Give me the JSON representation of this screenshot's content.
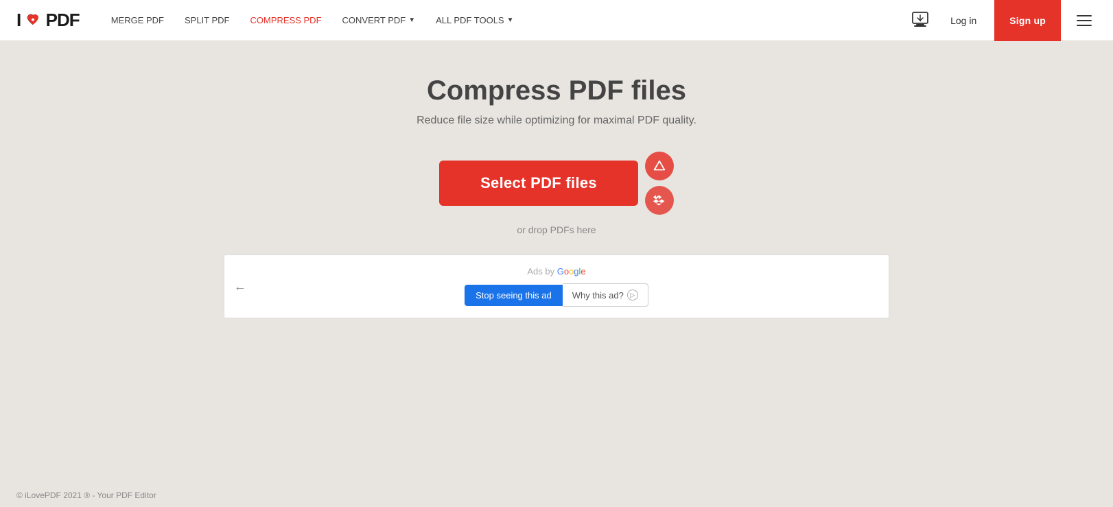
{
  "site": {
    "logo_i": "I",
    "logo_pdf": "PDF"
  },
  "nav": {
    "merge_label": "MERGE PDF",
    "split_label": "SPLIT PDF",
    "compress_label": "COMPRESS PDF",
    "convert_label": "CONVERT PDF",
    "all_tools_label": "ALL PDF TOOLS"
  },
  "header": {
    "login_label": "Log in",
    "signup_label": "Sign up"
  },
  "main": {
    "title": "Compress PDF files",
    "subtitle": "Reduce file size while optimizing for maximal PDF quality.",
    "select_btn_label": "Select PDF files",
    "drop_text": "or drop PDFs here"
  },
  "ad": {
    "ads_by": "Ads by",
    "google_text": "Google",
    "stop_label": "Stop seeing this ad",
    "why_label": "Why this ad?"
  },
  "footer": {
    "copyright": "© iLovePDF 2021 ® - Your PDF Editor"
  }
}
